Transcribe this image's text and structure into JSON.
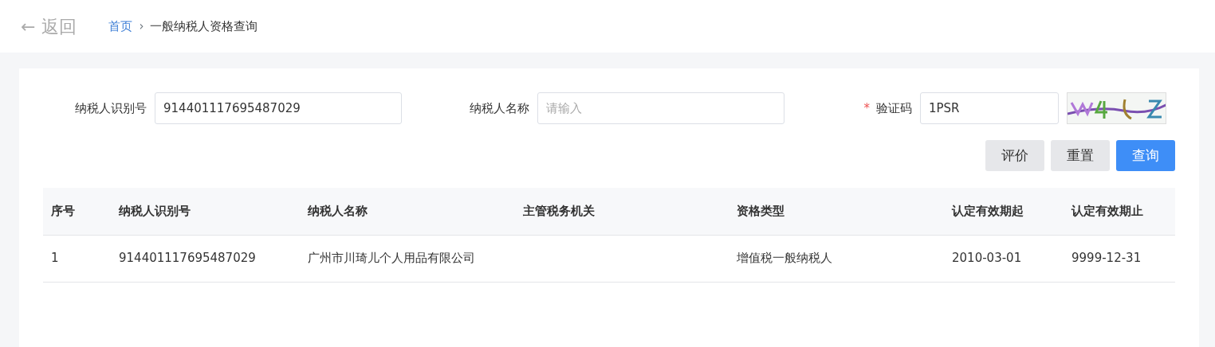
{
  "header": {
    "back": {
      "icon": "←",
      "label": "返回"
    },
    "separator": "›",
    "breadcrumb": [
      {
        "label": "首页",
        "link": true
      },
      {
        "label": "一般纳税人资格查询",
        "link": false
      }
    ]
  },
  "form": {
    "fields": [
      {
        "label": "纳税人识别号",
        "value": "914401117695487029"
      },
      {
        "label": "纳税人名称",
        "placeholder": "请输入"
      },
      {
        "label": "验证码",
        "required_mark": "*",
        "value": "1PSR",
        "kind": "captcha"
      }
    ],
    "buttons": [
      {
        "label": "评价",
        "kind": "secondary"
      },
      {
        "label": "重置",
        "kind": "secondary"
      },
      {
        "label": "查询",
        "kind": "primary"
      }
    ]
  },
  "table": {
    "columns": [
      "序号",
      "纳税人识别号",
      "纳税人名称",
      "主管税务机关",
      "资格类型",
      "认定有效期起",
      "认定有效期止"
    ],
    "rows": [
      [
        "1",
        "914401117695487029",
        "广州市川琦儿个人用品有限公司",
        "",
        "增值税一般纳税人",
        "2010-03-01",
        "9999-12-31"
      ]
    ]
  }
}
